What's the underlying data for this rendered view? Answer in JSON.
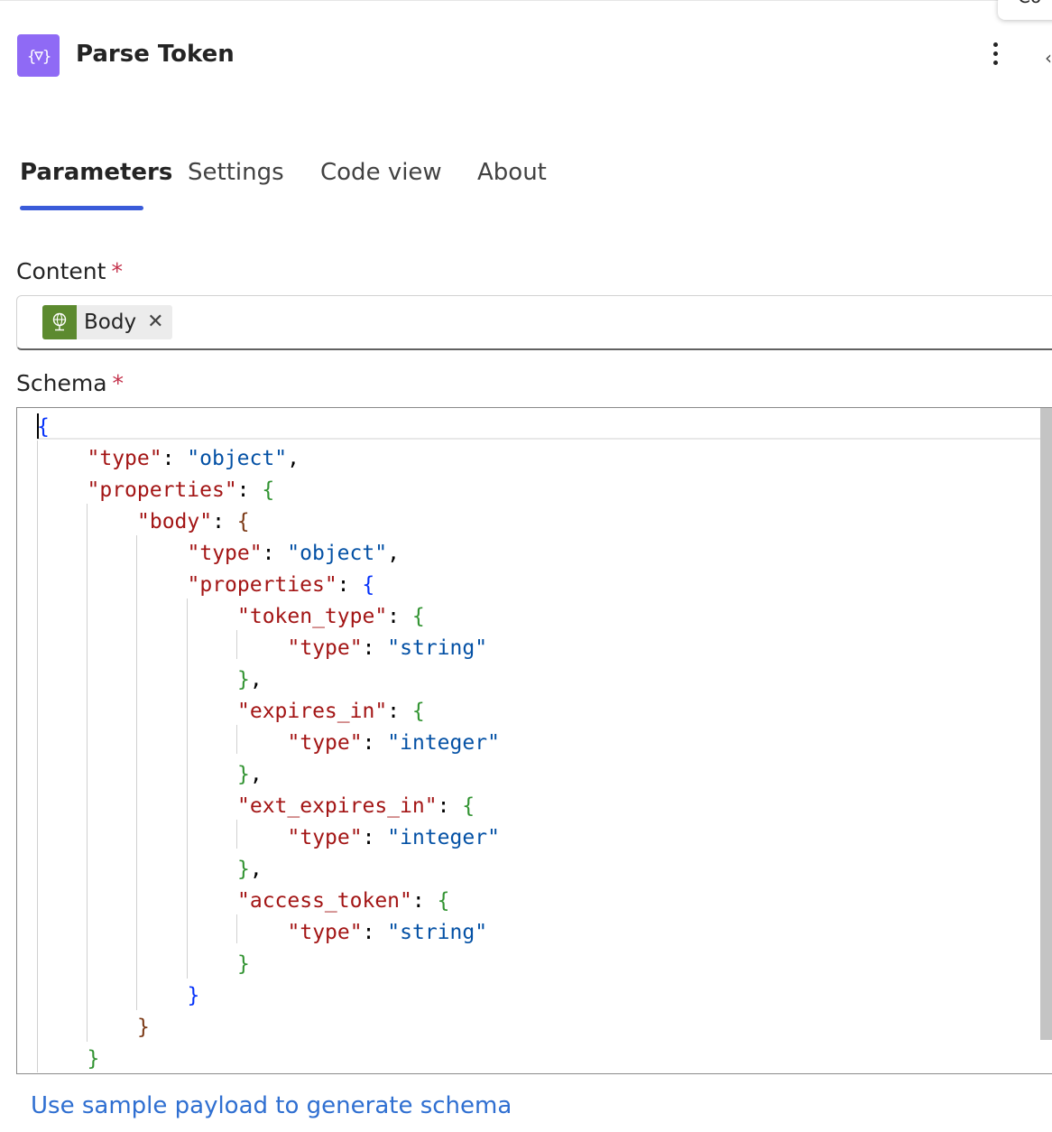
{
  "header": {
    "title": "Parse Token",
    "icon": "variable-braces-icon",
    "corner_popup_text": "Co"
  },
  "tabs": [
    {
      "label": "Parameters",
      "active": true
    },
    {
      "label": "Settings",
      "active": false
    },
    {
      "label": "Code view",
      "active": false
    },
    {
      "label": "About",
      "active": false
    }
  ],
  "content": {
    "label": "Content",
    "required_mark": "*",
    "token": {
      "label": "Body",
      "icon": "http-globe-icon",
      "color": "#5c8a2f"
    }
  },
  "schema": {
    "label": "Schema",
    "required_mark": "*",
    "lines": [
      [
        "{"
      ],
      [
        "\"type\"",
        ": ",
        "\"object\"",
        ","
      ],
      [
        "\"properties\"",
        ": ",
        "{"
      ],
      [
        "\"body\"",
        ": ",
        "{"
      ],
      [
        "\"type\"",
        ": ",
        "\"object\"",
        ","
      ],
      [
        "\"properties\"",
        ": ",
        "{"
      ],
      [
        "\"token_type\"",
        ": ",
        "{"
      ],
      [
        "\"type\"",
        ": ",
        "\"string\""
      ],
      [
        "}",
        ","
      ],
      [
        "\"expires_in\"",
        ": ",
        "{"
      ],
      [
        "\"type\"",
        ": ",
        "\"integer\""
      ],
      [
        "}",
        ","
      ],
      [
        "\"ext_expires_in\"",
        ": ",
        "{"
      ],
      [
        "\"type\"",
        ": ",
        "\"integer\""
      ],
      [
        "}",
        ","
      ],
      [
        "\"access_token\"",
        ": ",
        "{"
      ],
      [
        "\"type\"",
        ": ",
        "\"string\""
      ],
      [
        "}"
      ],
      [
        "}"
      ],
      [
        "}"
      ],
      [
        "}"
      ]
    ]
  },
  "sample_payload_link": "Use sample payload to generate schema",
  "colors": {
    "accent": "#3a5bd9",
    "icon_purple": "#8f6af5",
    "json_key": "#a31515",
    "json_string": "#0451a5",
    "link": "#2f6fd1"
  }
}
